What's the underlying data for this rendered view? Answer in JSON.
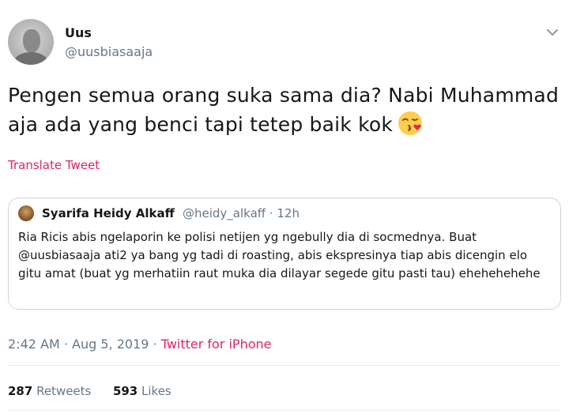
{
  "user": {
    "display_name": "Uus",
    "handle": "@uusbiasaaja"
  },
  "tweet": {
    "text": "Pengen semua orang suka sama dia? Nabi Muhammad aja ada yang benci tapi tetep baik kok",
    "emoji": "kissing-face-emoji",
    "translate_label": "Translate Tweet"
  },
  "quoted": {
    "display_name": "Syarifa Heidy Alkaff",
    "meta": "@heidy_alkaff · 12h",
    "text": "Ria Ricis abis ngelaporin ke polisi netijen yg ngebully dia di socmednya. Buat @uusbiasaaja ati2 ya bang yg tadi di roasting, abis ekspresinya tiap abis dicengin elo gitu amat (buat yg merhatiin raut muka dia dilayar segede gitu pasti tau) ehehehehehe"
  },
  "timestamp": {
    "time_date": "2:42 AM · Aug 5, 2019 · ",
    "source": "Twitter for iPhone"
  },
  "stats": {
    "retweets_count": "287",
    "retweets_label": " Retweets",
    "likes_count": "593",
    "likes_label": " Likes"
  },
  "colors": {
    "link": "#e0245e",
    "secondary_text": "#657786",
    "border": "#ccd6dd"
  }
}
